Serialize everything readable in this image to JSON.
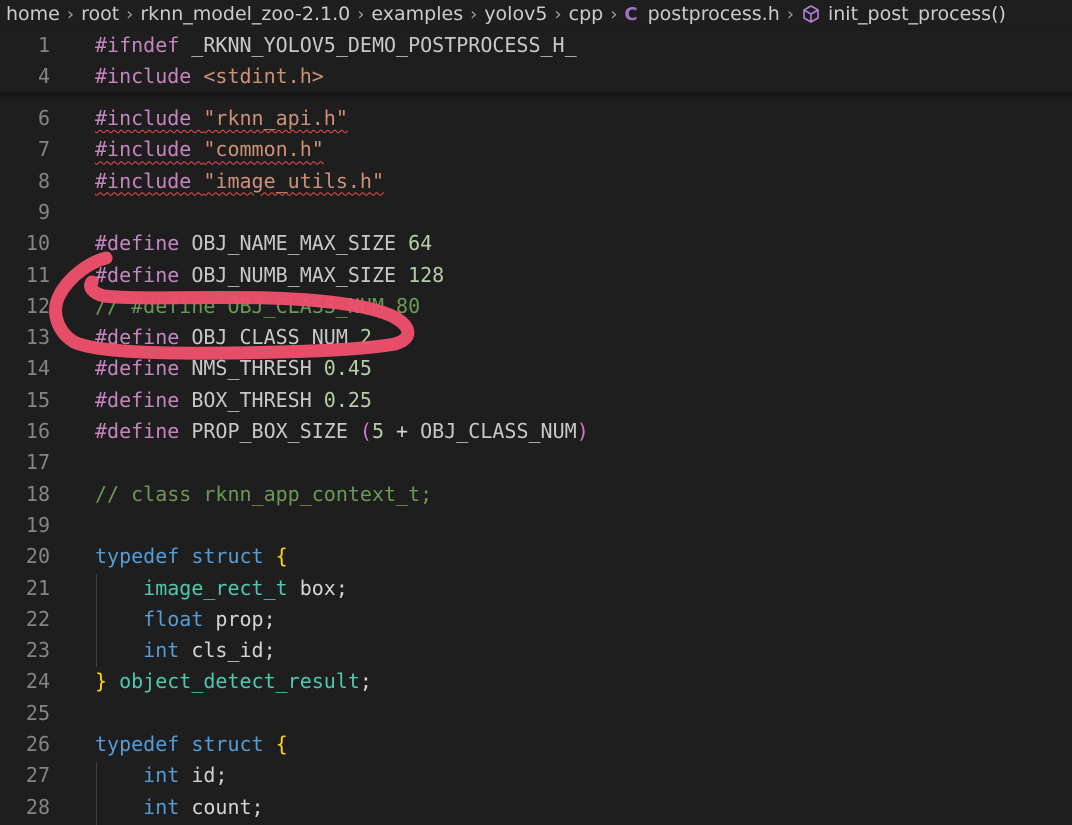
{
  "breadcrumb": {
    "items": [
      "home",
      "root",
      "rknn_model_zoo-2.1.0",
      "examples",
      "yolov5",
      "cpp"
    ],
    "file_icon": "C",
    "file": "postprocess.h",
    "symbol": "init_post_process()"
  },
  "sticky_lines": [
    {
      "num": "1",
      "parts": [
        {
          "t": "#ifndef ",
          "c": "pp"
        },
        {
          "t": "_RKNN_YOLOV5_DEMO_POSTPROCESS_H_",
          "c": "macro"
        }
      ]
    },
    {
      "num": "4",
      "parts": [
        {
          "t": "#include ",
          "c": "pp"
        },
        {
          "t": "<stdint.h>",
          "c": "str"
        }
      ]
    }
  ],
  "lines": [
    {
      "num": "6",
      "parts": [
        {
          "t": "#include ",
          "c": "pp",
          "sq": true
        },
        {
          "t": "\"rknn_api.h\"",
          "c": "str",
          "sq": true
        }
      ]
    },
    {
      "num": "7",
      "parts": [
        {
          "t": "#include ",
          "c": "pp",
          "sq": true
        },
        {
          "t": "\"common.h\"",
          "c": "str",
          "sq": true
        }
      ]
    },
    {
      "num": "8",
      "parts": [
        {
          "t": "#include ",
          "c": "pp",
          "sq": true
        },
        {
          "t": "\"image_utils.h\"",
          "c": "str",
          "sq": true
        }
      ]
    },
    {
      "num": "9",
      "parts": []
    },
    {
      "num": "10",
      "parts": [
        {
          "t": "#define ",
          "c": "pp"
        },
        {
          "t": "OBJ_NAME_MAX_SIZE",
          "c": "macro"
        },
        {
          "t": " ",
          "c": "plain"
        },
        {
          "t": "64",
          "c": "num"
        }
      ]
    },
    {
      "num": "11",
      "parts": [
        {
          "t": "#define ",
          "c": "pp"
        },
        {
          "t": "OBJ_NUMB_MAX_SIZE",
          "c": "macro"
        },
        {
          "t": " ",
          "c": "plain"
        },
        {
          "t": "128",
          "c": "num"
        }
      ]
    },
    {
      "num": "12",
      "parts": [
        {
          "t": "// #define OBJ_CLASS_NUM 80",
          "c": "cmt"
        }
      ]
    },
    {
      "num": "13",
      "parts": [
        {
          "t": "#define ",
          "c": "pp"
        },
        {
          "t": "OBJ_CLASS_NUM",
          "c": "macro"
        },
        {
          "t": " ",
          "c": "plain"
        },
        {
          "t": "2",
          "c": "num"
        }
      ]
    },
    {
      "num": "14",
      "parts": [
        {
          "t": "#define ",
          "c": "pp"
        },
        {
          "t": "NMS_THRESH",
          "c": "macro"
        },
        {
          "t": " ",
          "c": "plain"
        },
        {
          "t": "0.45",
          "c": "num"
        }
      ]
    },
    {
      "num": "15",
      "parts": [
        {
          "t": "#define ",
          "c": "pp"
        },
        {
          "t": "BOX_THRESH",
          "c": "macro"
        },
        {
          "t": " ",
          "c": "plain"
        },
        {
          "t": "0.25",
          "c": "num"
        }
      ]
    },
    {
      "num": "16",
      "parts": [
        {
          "t": "#define ",
          "c": "pp"
        },
        {
          "t": "PROP_BOX_SIZE",
          "c": "macro"
        },
        {
          "t": " ",
          "c": "plain"
        },
        {
          "t": "(",
          "c": "paren"
        },
        {
          "t": "5",
          "c": "num"
        },
        {
          "t": " + ",
          "c": "plain"
        },
        {
          "t": "OBJ_CLASS_NUM",
          "c": "macro"
        },
        {
          "t": ")",
          "c": "paren"
        }
      ]
    },
    {
      "num": "17",
      "parts": []
    },
    {
      "num": "18",
      "parts": [
        {
          "t": "// class rknn_app_context_t;",
          "c": "cmt"
        }
      ]
    },
    {
      "num": "19",
      "parts": []
    },
    {
      "num": "20",
      "parts": [
        {
          "t": "typedef",
          "c": "kw"
        },
        {
          "t": " ",
          "c": "plain"
        },
        {
          "t": "struct",
          "c": "kw"
        },
        {
          "t": " ",
          "c": "plain"
        },
        {
          "t": "{",
          "c": "brace"
        }
      ]
    },
    {
      "num": "21",
      "parts": [
        {
          "t": "    ",
          "c": "plain"
        },
        {
          "t": "image_rect_t",
          "c": "type"
        },
        {
          "t": " box;",
          "c": "plain"
        }
      ]
    },
    {
      "num": "22",
      "parts": [
        {
          "t": "    ",
          "c": "plain"
        },
        {
          "t": "float",
          "c": "kw"
        },
        {
          "t": " prop;",
          "c": "plain"
        }
      ]
    },
    {
      "num": "23",
      "parts": [
        {
          "t": "    ",
          "c": "plain"
        },
        {
          "t": "int",
          "c": "kw"
        },
        {
          "t": " cls_id;",
          "c": "plain"
        }
      ]
    },
    {
      "num": "24",
      "parts": [
        {
          "t": "}",
          "c": "brace"
        },
        {
          "t": " ",
          "c": "plain"
        },
        {
          "t": "object_detect_result",
          "c": "type"
        },
        {
          "t": ";",
          "c": "plain"
        }
      ]
    },
    {
      "num": "25",
      "parts": []
    },
    {
      "num": "26",
      "parts": [
        {
          "t": "typedef",
          "c": "kw"
        },
        {
          "t": " ",
          "c": "plain"
        },
        {
          "t": "struct",
          "c": "kw"
        },
        {
          "t": " ",
          "c": "plain"
        },
        {
          "t": "{",
          "c": "brace"
        }
      ]
    },
    {
      "num": "27",
      "parts": [
        {
          "t": "    ",
          "c": "plain"
        },
        {
          "t": "int",
          "c": "kw"
        },
        {
          "t": " id;",
          "c": "plain"
        }
      ]
    },
    {
      "num": "28",
      "parts": [
        {
          "t": "    ",
          "c": "plain"
        },
        {
          "t": "int",
          "c": "kw"
        },
        {
          "t": " count;",
          "c": "plain"
        }
      ]
    }
  ]
}
